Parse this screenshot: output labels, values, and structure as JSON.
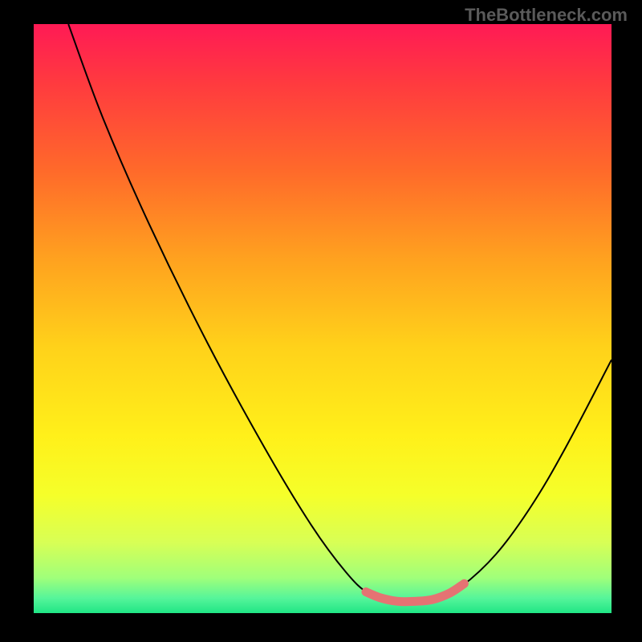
{
  "watermark": "TheBottleneck.com",
  "chart_data": {
    "type": "line",
    "title": "",
    "xlabel": "",
    "ylabel": "",
    "xlim": [
      0,
      100
    ],
    "ylim": [
      0,
      100
    ],
    "background_gradient": {
      "stops": [
        {
          "offset": 0.0,
          "color": "#ff1a55"
        },
        {
          "offset": 0.1,
          "color": "#ff3a3f"
        },
        {
          "offset": 0.25,
          "color": "#ff6a2a"
        },
        {
          "offset": 0.4,
          "color": "#ffa21f"
        },
        {
          "offset": 0.55,
          "color": "#ffd21a"
        },
        {
          "offset": 0.7,
          "color": "#fff01a"
        },
        {
          "offset": 0.8,
          "color": "#f5ff2a"
        },
        {
          "offset": 0.88,
          "color": "#d8ff55"
        },
        {
          "offset": 0.94,
          "color": "#a0ff7a"
        },
        {
          "offset": 0.975,
          "color": "#55f59a"
        },
        {
          "offset": 1.0,
          "color": "#20e585"
        }
      ]
    },
    "series": [
      {
        "name": "bottleneck-curve",
        "color": "#000000",
        "width": 2,
        "points": [
          {
            "x": 6.0,
            "y": 100.0
          },
          {
            "x": 12.0,
            "y": 84.0
          },
          {
            "x": 20.0,
            "y": 66.0
          },
          {
            "x": 30.0,
            "y": 46.0
          },
          {
            "x": 40.0,
            "y": 28.0
          },
          {
            "x": 48.0,
            "y": 15.0
          },
          {
            "x": 54.0,
            "y": 7.0
          },
          {
            "x": 58.0,
            "y": 3.3
          },
          {
            "x": 62.0,
            "y": 2.0
          },
          {
            "x": 66.0,
            "y": 2.0
          },
          {
            "x": 70.0,
            "y": 2.5
          },
          {
            "x": 74.0,
            "y": 4.5
          },
          {
            "x": 80.0,
            "y": 10.0
          },
          {
            "x": 86.0,
            "y": 18.0
          },
          {
            "x": 92.0,
            "y": 28.0
          },
          {
            "x": 100.0,
            "y": 43.0
          }
        ]
      },
      {
        "name": "optimal-band",
        "color": "#e57373",
        "width": 11,
        "points": [
          {
            "x": 57.5,
            "y": 3.6
          },
          {
            "x": 60.0,
            "y": 2.6
          },
          {
            "x": 63.0,
            "y": 2.0
          },
          {
            "x": 66.0,
            "y": 2.0
          },
          {
            "x": 69.0,
            "y": 2.3
          },
          {
            "x": 72.0,
            "y": 3.4
          },
          {
            "x": 74.5,
            "y": 5.0
          }
        ]
      }
    ]
  }
}
